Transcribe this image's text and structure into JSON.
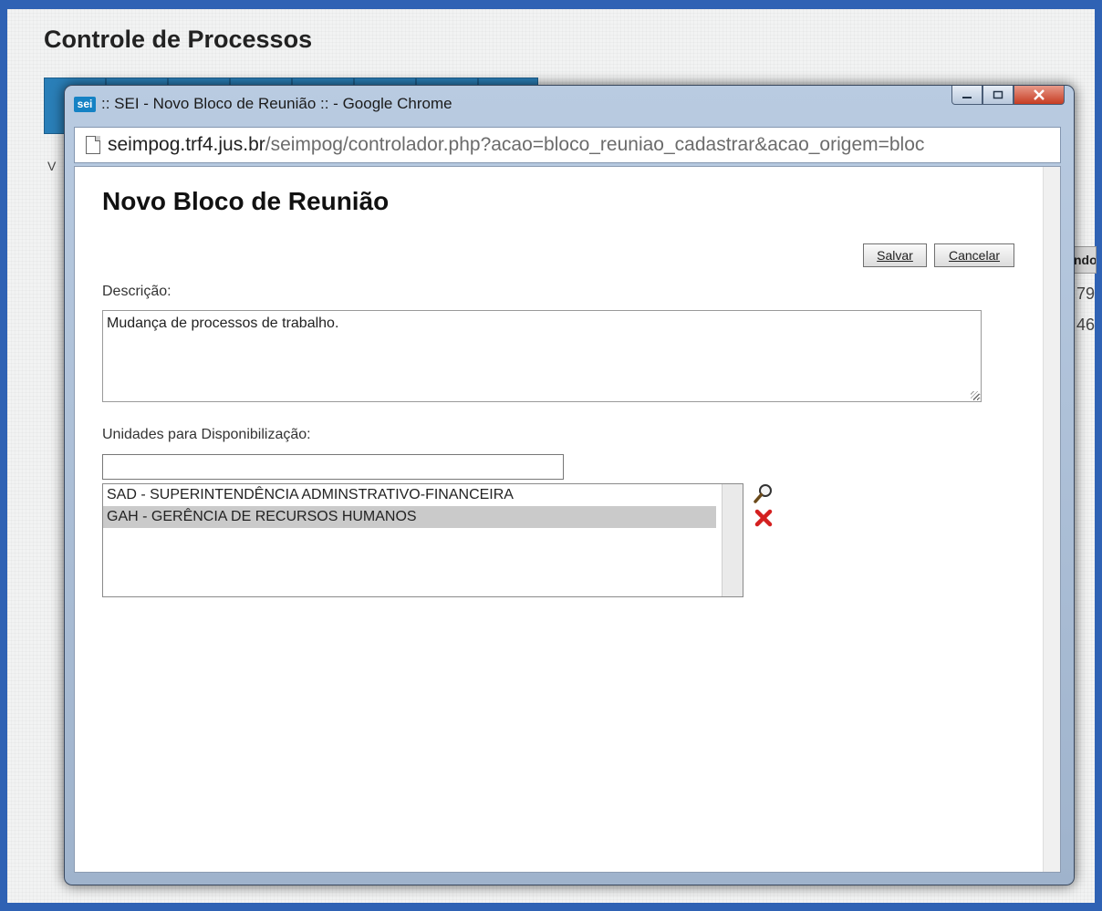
{
  "background": {
    "title": "Controle de Processos",
    "side_text": "V",
    "col_head": "ndo",
    "rows": [
      "79",
      "46"
    ]
  },
  "window": {
    "icon_label": "sei",
    "title": ":: SEI - Novo Bloco de Reunião :: - Google Chrome",
    "url_host": "seimpog.trf4.jus.br",
    "url_path": "/seimpog/controlador.php?acao=bloco_reuniao_cadastrar&acao_origem=bloc"
  },
  "form": {
    "heading": "Novo Bloco de Reunião",
    "save_label": "Salvar",
    "cancel_label": "Cancelar",
    "description_label": "Descrição:",
    "description_value": "Mudança de processos de trabalho.",
    "units_label": "Unidades para Disponibilização:",
    "units_search_value": "",
    "units": [
      {
        "label": "SAD - SUPERINTENDÊNCIA ADMINSTRATIVO-FINANCEIRA",
        "selected": false
      },
      {
        "label": "GAH - GERÊNCIA DE RECURSOS HUMANOS",
        "selected": true
      }
    ]
  },
  "icons": {
    "search": "search-icon",
    "remove": "remove-icon",
    "page": "page-icon"
  },
  "colors": {
    "frame": "#2f62b4",
    "toolbar": "#2a7fb8",
    "remove_icon": "#d42020",
    "selected_row": "#cacaca"
  }
}
